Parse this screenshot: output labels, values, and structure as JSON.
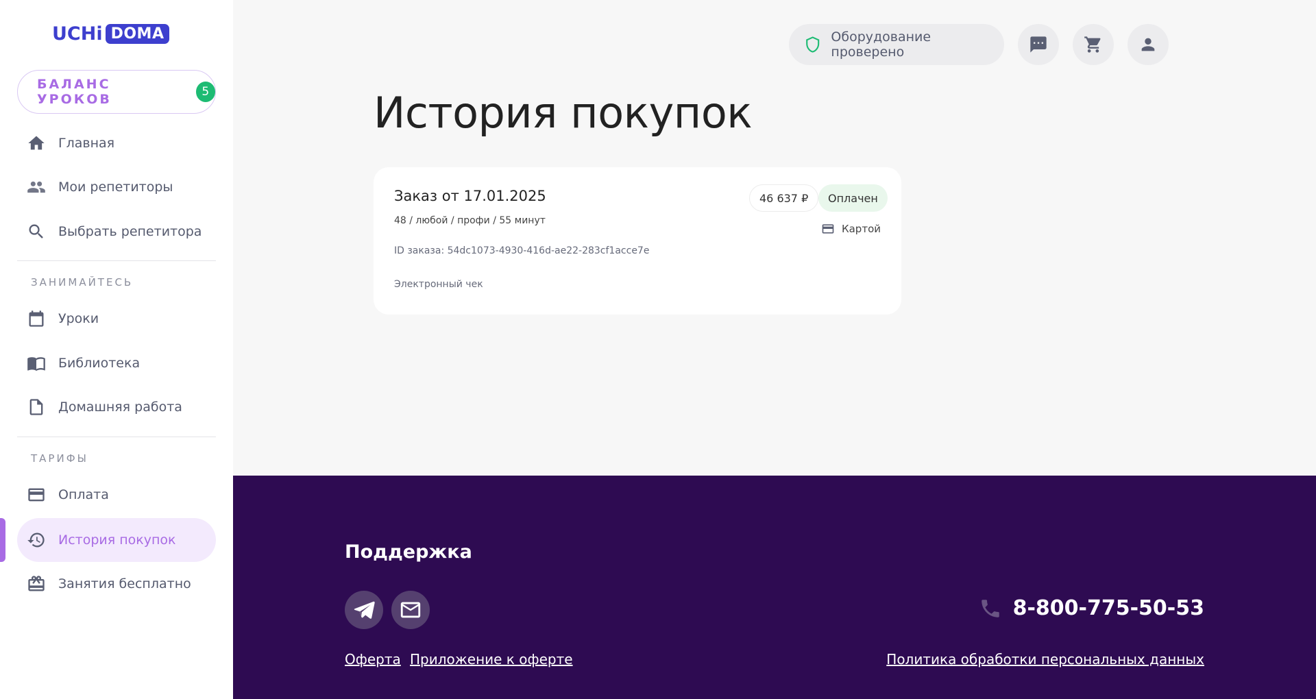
{
  "logo": {
    "part1": "UCHi",
    "part2": "DOMA"
  },
  "balance": {
    "label": "БАЛАНС УРОКОВ",
    "count": "5"
  },
  "sidebar": {
    "items_top": [
      {
        "label": "Главная",
        "icon": "home-icon"
      },
      {
        "label": "Мои репетиторы",
        "icon": "people-icon"
      },
      {
        "label": "Выбрать репетитора",
        "icon": "search-icon"
      }
    ],
    "section1": "ЗАНИМАЙТЕСЬ",
    "items_mid": [
      {
        "label": "Уроки",
        "icon": "calendar-icon"
      },
      {
        "label": "Библиотека",
        "icon": "book-icon"
      },
      {
        "label": "Домашняя работа",
        "icon": "document-icon"
      }
    ],
    "section2": "ТАРИФЫ",
    "items_bottom": [
      {
        "label": "Оплата",
        "icon": "credit-card-icon"
      },
      {
        "label": "История покупок",
        "icon": "history-icon",
        "active": true
      },
      {
        "label": "Занятия бесплатно",
        "icon": "gift-icon"
      }
    ]
  },
  "header": {
    "hw_status": "Оборудование проверено"
  },
  "page": {
    "title": "История покупок"
  },
  "order": {
    "title": "Заказ от 17.01.2025",
    "details": "48 / любой / профи / 55 минут",
    "id": "ID заказа: 54dc1073-4930-416d-ae22-283cf1acce7e",
    "receipt": "Электронный чек",
    "price": "46 637 ₽",
    "status": "Оплачен",
    "payment_method": "Картой"
  },
  "footer": {
    "support_title": "Поддержка",
    "phone": "8-800-775-50-53",
    "links": {
      "offer": "Оферта",
      "offer_appendix": "Приложение к оферте",
      "privacy": "Политика обработки персональных данных"
    }
  },
  "colors": {
    "accent": "#a86be4",
    "brand": "#3d3fce",
    "footer_bg": "#2e0b52",
    "badge_green": "#1dbb73"
  }
}
